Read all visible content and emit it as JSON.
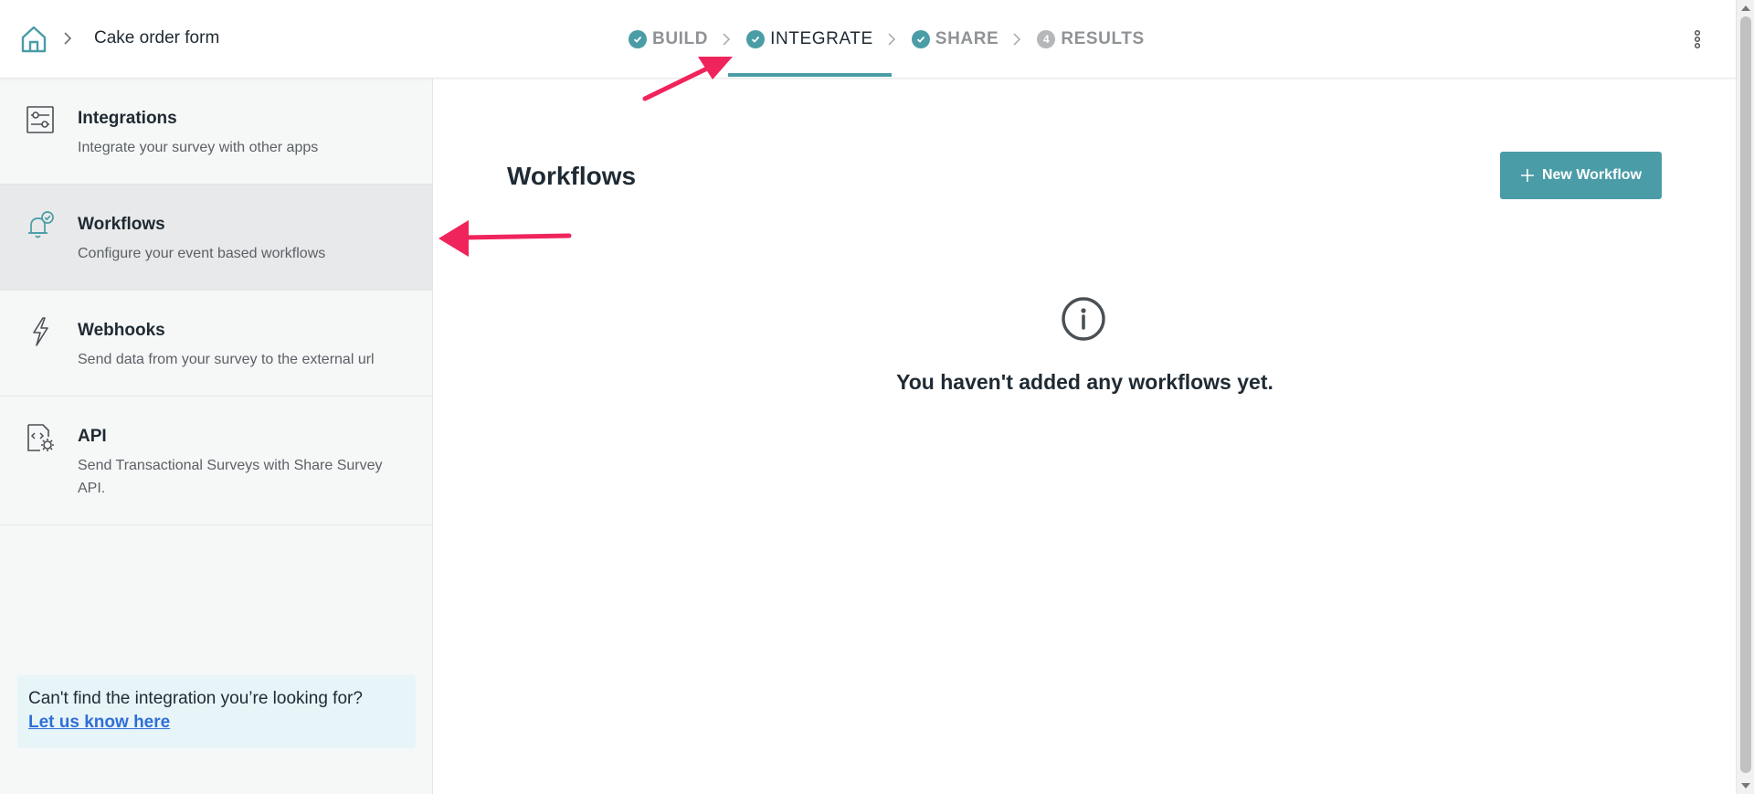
{
  "header": {
    "form_title": "Cake order form",
    "steps": [
      {
        "label": "BUILD",
        "state": "done"
      },
      {
        "label": "INTEGRATE",
        "state": "active"
      },
      {
        "label": "SHARE",
        "state": "done"
      },
      {
        "label": "RESULTS",
        "state": "pending",
        "number": "4"
      }
    ]
  },
  "sidebar": {
    "items": [
      {
        "title": "Integrations",
        "description": "Integrate your survey with other apps",
        "icon": "sliders-icon"
      },
      {
        "title": "Workflows",
        "description": "Configure your event based workflows",
        "icon": "bell-check-icon"
      },
      {
        "title": "Webhooks",
        "description": "Send data from your survey to the external url",
        "icon": "lightning-icon"
      },
      {
        "title": "API",
        "description": "Send Transactional Surveys with Share Survey API.",
        "icon": "code-gear-icon"
      }
    ],
    "help": {
      "text": "Can't find the integration you’re looking for?",
      "link": "Let us know here"
    }
  },
  "main": {
    "title": "Workflows",
    "new_button": "New Workflow",
    "empty_message": "You haven't added any workflows yet."
  },
  "colors": {
    "accent": "#4a9ca6",
    "annotation": "#f0245c",
    "link": "#2f6fd6"
  }
}
